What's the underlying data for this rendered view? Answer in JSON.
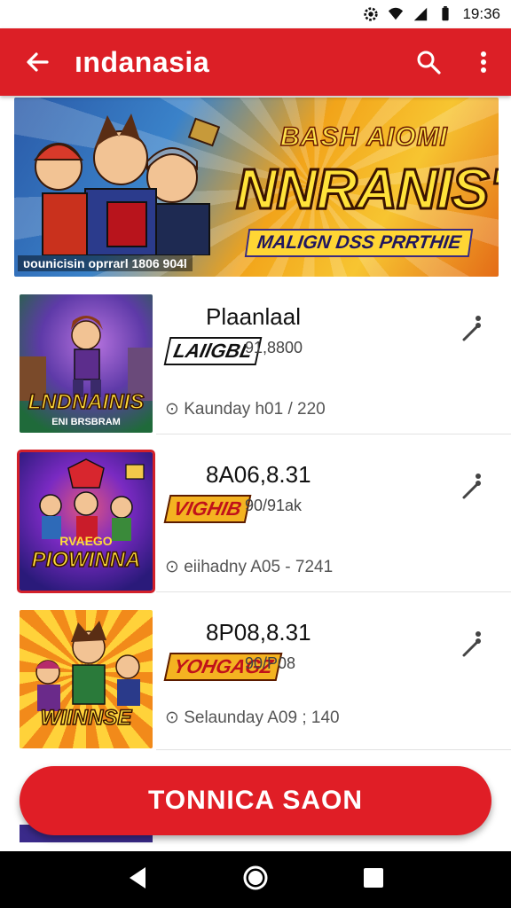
{
  "status_bar": {
    "time": "19:36"
  },
  "app_bar": {
    "title": "ındanasia"
  },
  "banner": {
    "headline_top": "BASH AIOMI",
    "headline_main": "NNRANIS\"",
    "headline_sub": "MALIGN DSS PRRTHIE",
    "caption": "ʋounicisin oprrarl 1806 904l"
  },
  "items": [
    {
      "title": "Plaanlaal",
      "badge": "LAIlGBL",
      "meta": "91,8800",
      "date": "Kaunday h01 / 220",
      "thumb_title": "LNDNAINIS",
      "thumb_subtitle": "ENI BRSBRAM"
    },
    {
      "title": "8A06,8.31",
      "badge": "VIGHIB",
      "meta": "90/91ak",
      "date": "eiihadny A05 - 7241",
      "thumb_title": "PIOWINNA",
      "thumb_subtitle": "RVAEGO"
    },
    {
      "title": "8P08,8.31",
      "badge": "YOHGAGZ",
      "meta": "90/P08",
      "date": "Selaunday A09 ; 140",
      "thumb_title": "WIINNSE",
      "thumb_subtitle": ""
    }
  ],
  "cta": {
    "label": "TONNICA SAON"
  },
  "colors": {
    "brand_red": "#dc1f26",
    "banner_yellow": "#ffe33a"
  },
  "icons": {
    "back": "arrow-left-icon",
    "search": "search-icon",
    "overflow": "more-vert-icon",
    "item_more": "more-vert-icon",
    "nav_back": "triangle-back-icon",
    "nav_home": "circle-home-icon",
    "nav_recents": "square-recents-icon"
  }
}
